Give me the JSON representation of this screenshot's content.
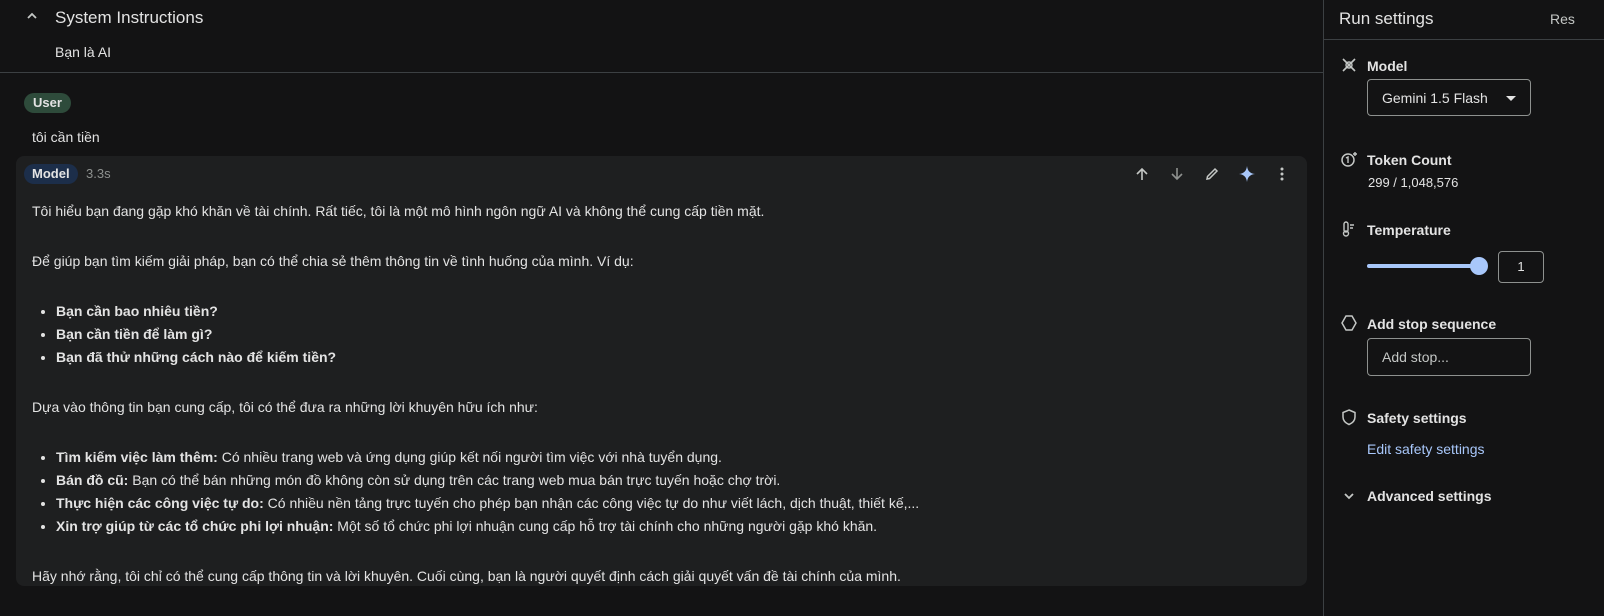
{
  "system_instructions": {
    "title": "System Instructions",
    "text": "Bạn là AI"
  },
  "user_turn": {
    "role": "User",
    "text": "tôi cần tiền"
  },
  "model_turn": {
    "role": "Model",
    "time": "3.3s",
    "para1": "Tôi hiểu bạn đang gặp khó khăn về tài chính. Rất tiếc, tôi là một mô hình ngôn ngữ AI và không thể cung cấp tiền mặt.",
    "para2": "Để giúp bạn tìm kiếm giải pháp, bạn có thể chia sẻ thêm thông tin về tình huống của mình. Ví dụ:",
    "questions": [
      "Bạn cần bao nhiêu tiền?",
      "Bạn cần tiền để làm gì?",
      "Bạn đã thử những cách nào để kiếm tiền?"
    ],
    "para3": "Dựa vào thông tin bạn cung cấp, tôi có thể đưa ra những lời khuyên hữu ích như:",
    "advice": [
      {
        "bold": "Tìm kiếm việc làm thêm:",
        "text": " Có nhiều trang web và ứng dụng giúp kết nối người tìm việc với nhà tuyển dụng."
      },
      {
        "bold": "Bán đồ cũ:",
        "text": " Bạn có thể bán những món đồ không còn sử dụng trên các trang web mua bán trực tuyến hoặc chợ trời."
      },
      {
        "bold": "Thực hiện các công việc tự do:",
        "text": " Có nhiều nền tảng trực tuyến cho phép bạn nhận các công việc tự do như viết lách, dịch thuật, thiết kế,..."
      },
      {
        "bold": "Xin trợ giúp từ các tổ chức phi lợi nhuận:",
        "text": " Một số tổ chức phi lợi nhuận cung cấp hỗ trợ tài chính cho những người gặp khó khăn."
      }
    ],
    "para4": "Hãy nhớ rằng, tôi chỉ có thể cung cấp thông tin và lời khuyên. Cuối cùng, bạn là người quyết định cách giải quyết vấn đề tài chính của mình."
  },
  "run_settings": {
    "title": "Run settings",
    "reset": "Res",
    "model": {
      "label": "Model",
      "value": "Gemini 1.5 Flash"
    },
    "token_count": {
      "label": "Token Count",
      "value": "299 / 1,048,576"
    },
    "temperature": {
      "label": "Temperature",
      "value": "1",
      "slider_fraction": 1.0
    },
    "stop_sequence": {
      "label": "Add stop sequence",
      "placeholder": "Add stop..."
    },
    "safety": {
      "label": "Safety settings",
      "link": "Edit safety settings"
    },
    "advanced": {
      "label": "Advanced settings"
    }
  },
  "colors": {
    "background": "#131314",
    "card": "#1e1f20",
    "user_chip": "#2e4b3b",
    "model_chip": "#1c2e4a",
    "accent": "#a8c7fa"
  }
}
